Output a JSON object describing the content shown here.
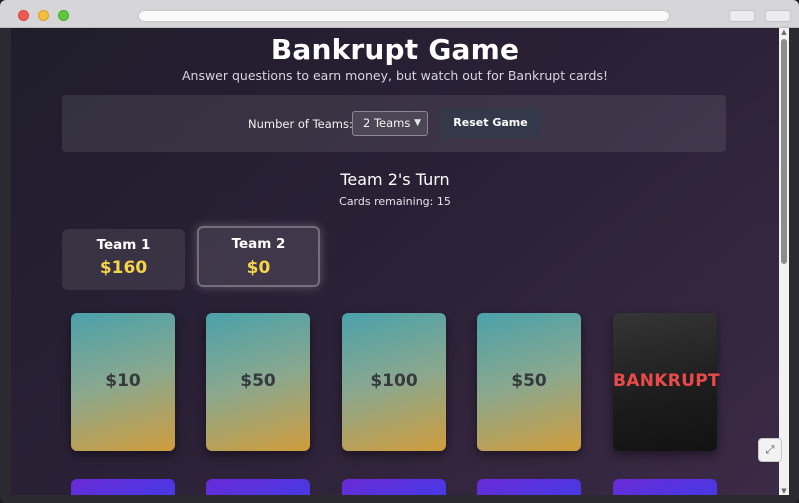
{
  "page": {
    "title": "Bankrupt Game",
    "subtitle": "Answer questions to earn money, but watch out for Bankrupt cards!"
  },
  "controls": {
    "teams_label": "Number of Teams:",
    "teams_selected": "2 Teams",
    "reset_label": "Reset Game"
  },
  "status": {
    "turn": "Team 2's Turn",
    "cards_remaining": "Cards remaining: 15"
  },
  "teams": [
    {
      "name": "Team 1",
      "score": "$160",
      "active": false
    },
    {
      "name": "Team 2",
      "score": "$0",
      "active": true
    }
  ],
  "cards": [
    {
      "label": "$10",
      "kind": "money"
    },
    {
      "label": "$50",
      "kind": "money"
    },
    {
      "label": "$100",
      "kind": "money"
    },
    {
      "label": "$50",
      "kind": "money"
    },
    {
      "label": "BANKRUPT",
      "kind": "bankrupt"
    }
  ],
  "icons": {
    "select_chevron": "chevron-down-icon",
    "scroll_up": "scroll-up-arrow-icon",
    "scroll_down": "scroll-down-arrow-icon",
    "expand": "expand-icon"
  },
  "colors": {
    "score": "#f6d44a",
    "bankrupt_text": "#ec4a4a",
    "card_gradient_top": "#4aa1ab",
    "card_gradient_bottom": "#d09c3c",
    "hidden_card": "#5a33dd"
  }
}
